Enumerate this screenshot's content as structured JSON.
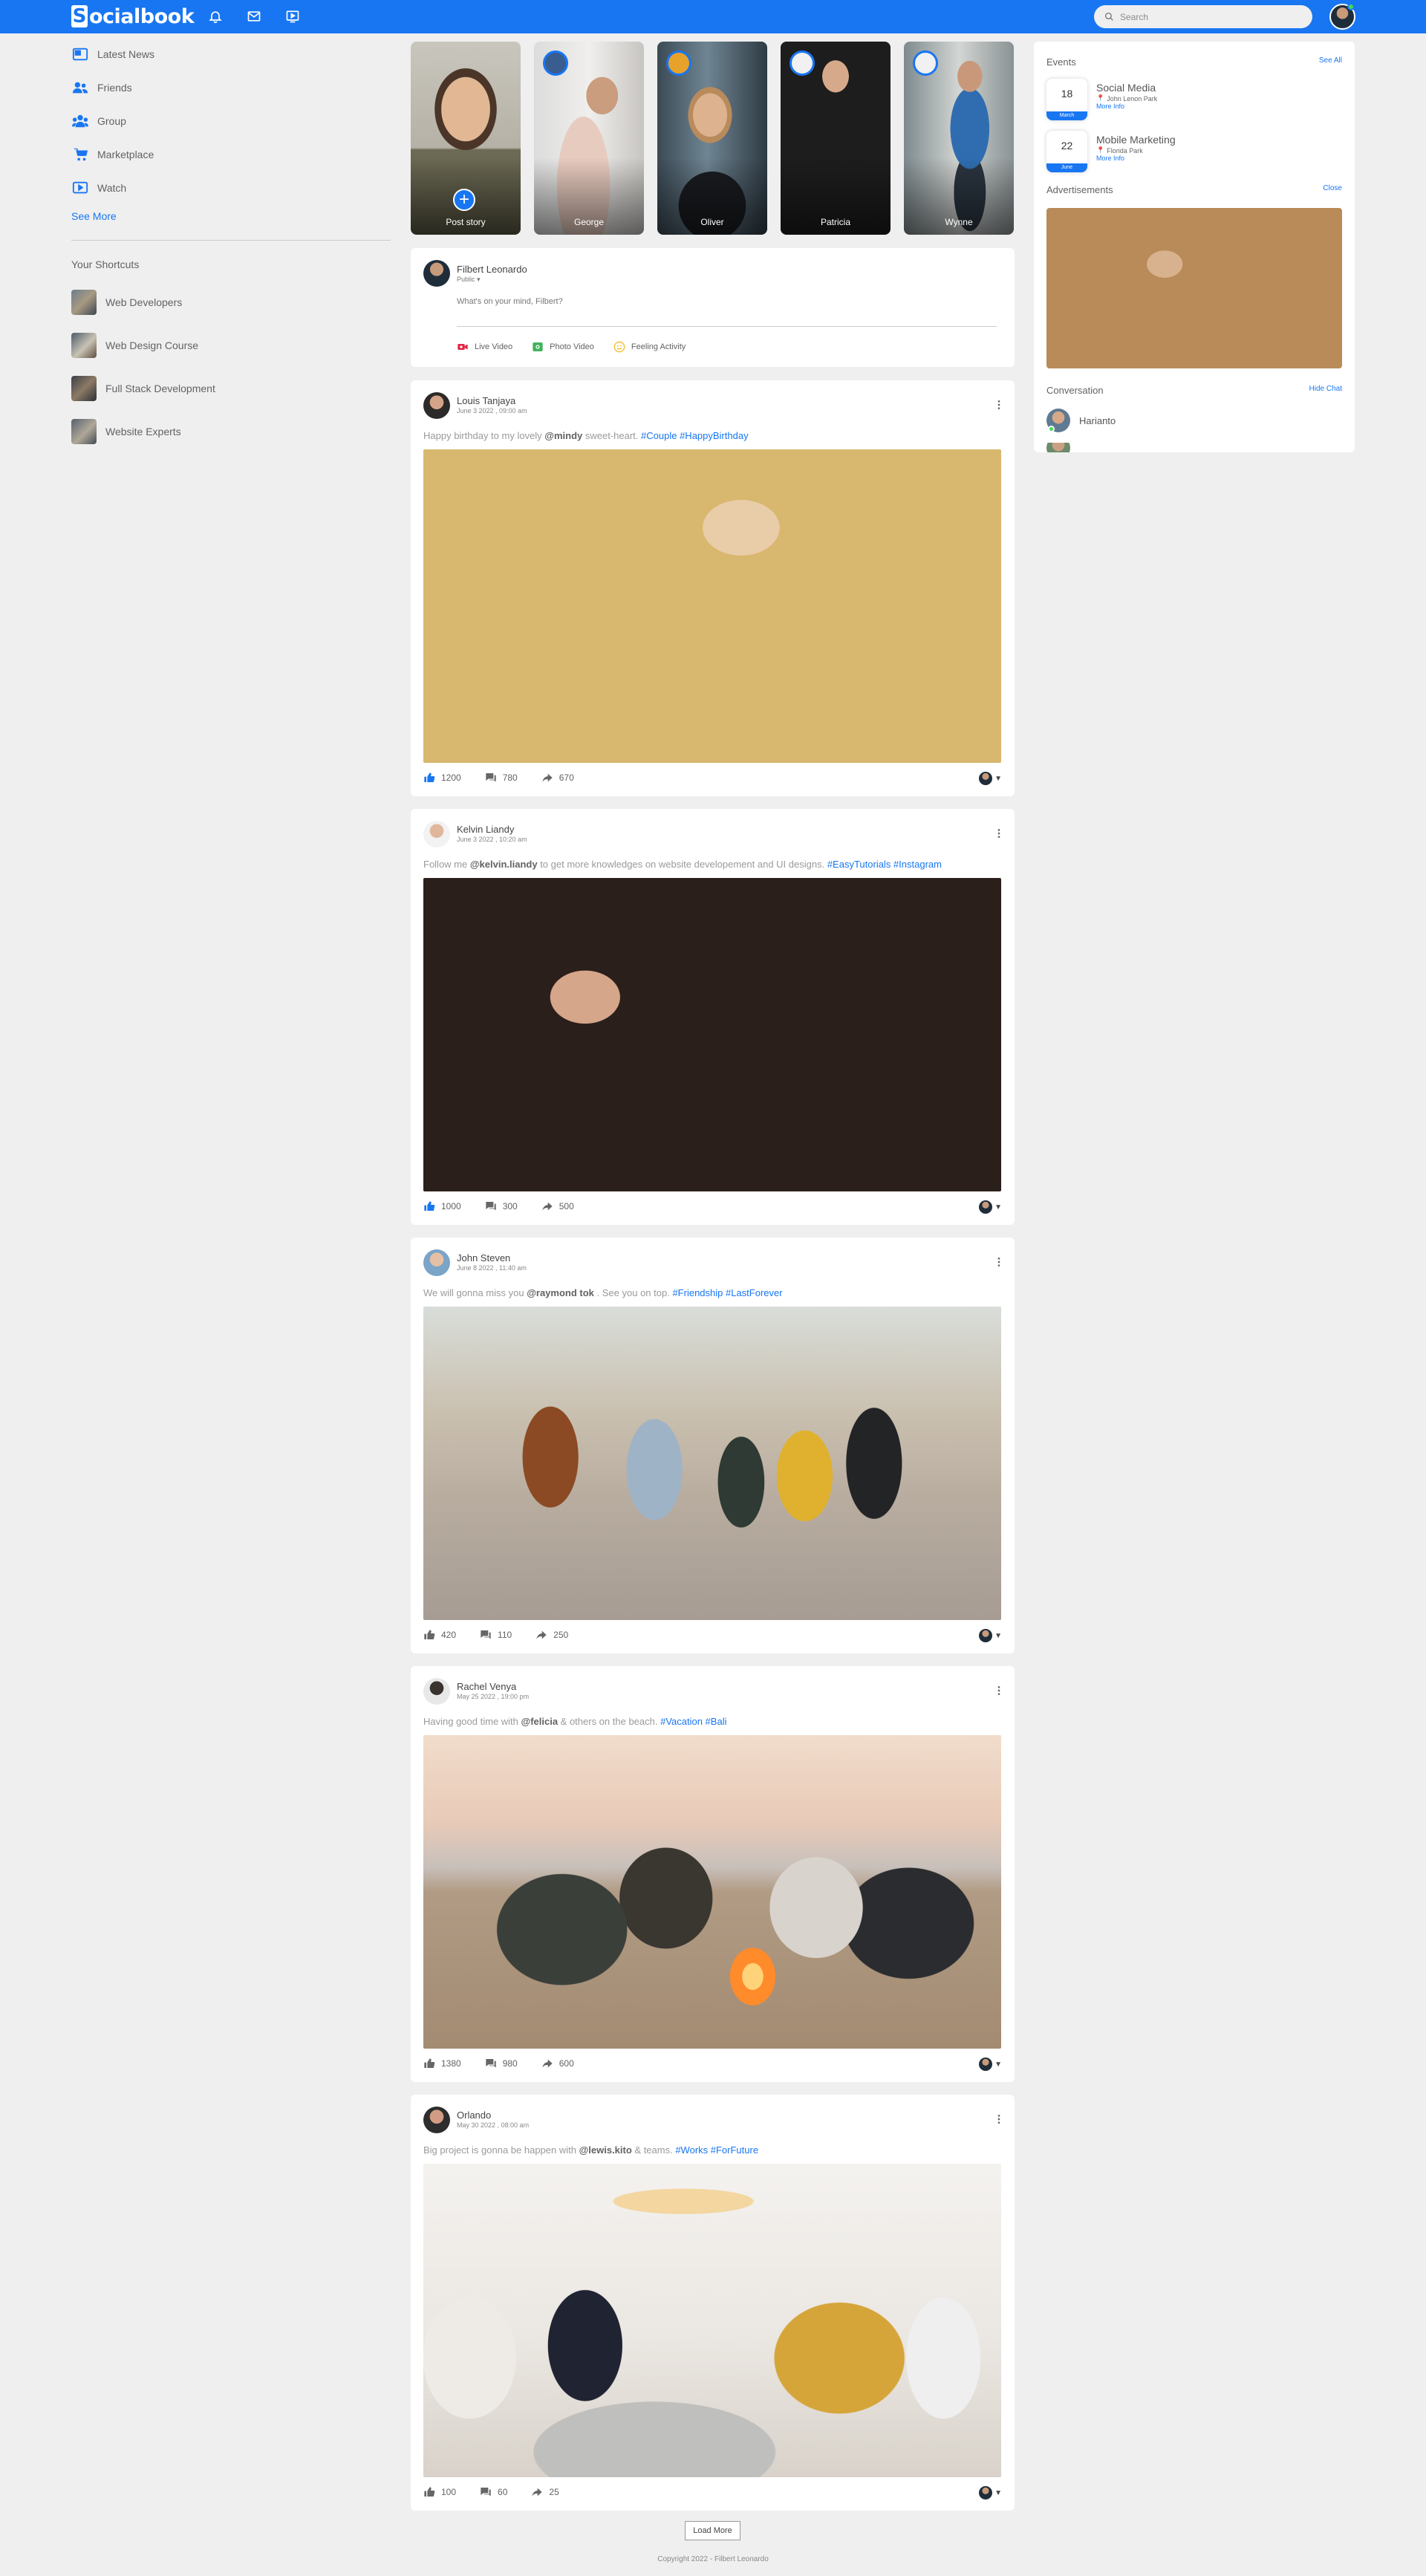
{
  "nav": {
    "logo_letter": "S",
    "logo_text": "ocialbook",
    "search_placeholder": "Search"
  },
  "sidebar": {
    "links": [
      {
        "label": "Latest News",
        "icon": "news-icon"
      },
      {
        "label": "Friends",
        "icon": "friends-icon"
      },
      {
        "label": "Group",
        "icon": "group-icon"
      },
      {
        "label": "Marketplace",
        "icon": "cart-icon"
      },
      {
        "label": "Watch",
        "icon": "watch-icon"
      }
    ],
    "see_more": "See More",
    "shortcuts_title": "Your Shortcuts",
    "shortcuts": [
      "Web Developers",
      "Web Design Course",
      "Full Stack Development",
      "Website Experts"
    ]
  },
  "stories": [
    "Post story",
    "George",
    "Oliver",
    "Patricia",
    "Wynne"
  ],
  "write_post": {
    "user": "Filbert Leonardo",
    "privacy": "Public",
    "placeholder": "What's on your mind, Filbert?",
    "actions": [
      "Live Video",
      "Photo Video",
      "Feeling Activity"
    ]
  },
  "posts": [
    {
      "user": "Louis Tanjaya",
      "date": "June 3 2022 , 09:00 am",
      "text_before": "Happy birthday to my lovely ",
      "mention": "@mindy",
      "text_after": " sweet-heart. ",
      "tags": "#Couple #HappyBirthday",
      "likes": "1200",
      "comments": "780",
      "shares": "670"
    },
    {
      "user": "Kelvin Liandy",
      "date": "June 3 2022 , 10:20 am",
      "text_before": "Follow me ",
      "mention": "@kelvin.liandy",
      "text_after": " to get more knowledges on website developement and UI designs. ",
      "tags": "#EasyTutorials #Instagram",
      "likes": "1000",
      "comments": "300",
      "shares": "500"
    },
    {
      "user": "John Steven",
      "date": "June 8 2022 , 11:40 am",
      "text_before": "We will gonna miss you ",
      "mention": "@raymond tok",
      "text_after": " . See you on top. ",
      "tags": "#Friendship #LastForever",
      "likes": "420",
      "comments": "110",
      "shares": "250"
    },
    {
      "user": "Rachel Venya",
      "date": "May 25 2022 , 19:00 pm",
      "text_before": "Having good time with ",
      "mention": "@felicia",
      "text_after": " & others on the beach. ",
      "tags": "#Vacation #Bali",
      "likes": "1380",
      "comments": "980",
      "shares": "600"
    },
    {
      "user": "Orlando",
      "date": "May 30 2022 , 08:00 am",
      "text_before": "Big project is gonna be happen with ",
      "mention": "@lewis.kito",
      "text_after": " & teams. ",
      "tags": "#Works #ForFuture",
      "likes": "100",
      "comments": "60",
      "shares": "25"
    }
  ],
  "right": {
    "events_title": "Events",
    "see_all": "See All",
    "events": [
      {
        "day": "18",
        "month": "March",
        "title": "Social Media",
        "location": "John Lenon Park",
        "more": "More Info"
      },
      {
        "day": "22",
        "month": "June",
        "title": "Mobile Marketing",
        "location": "Florida Park",
        "more": "More Info"
      }
    ],
    "ads_title": "Advertisements",
    "ads_close": "Close",
    "conversation_title": "Conversation",
    "hide_chat": "Hide Chat",
    "conversations": [
      "Harianto"
    ]
  },
  "load_more": "Load More",
  "footer": "Copyright 2022 - Filbert Leonardo",
  "colors": {
    "brand": "#1876f2",
    "online": "#41db51",
    "background": "#efefef"
  }
}
